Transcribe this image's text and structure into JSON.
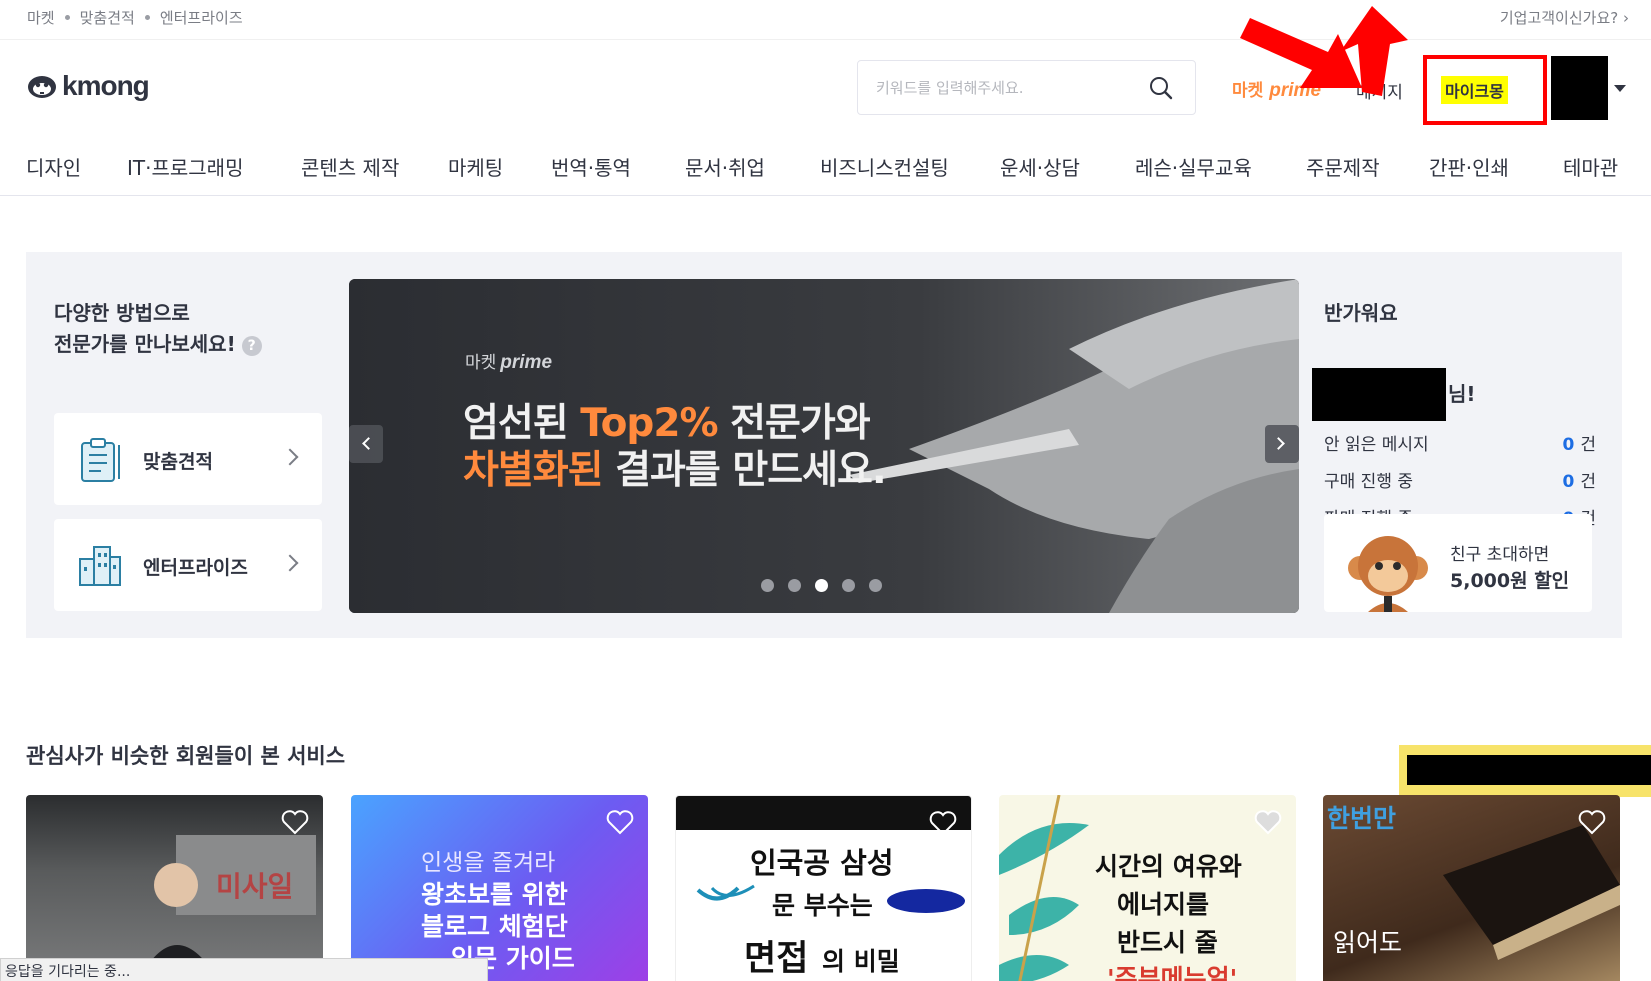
{
  "topbar": {
    "crumbs": [
      "마켓",
      "맞춤견적",
      "엔터프라이즈"
    ],
    "enterprise_link": "기업고객이신가요?"
  },
  "header": {
    "logo_text": "kmong",
    "search_placeholder": "키워드를 입력해주세요.",
    "prime_label_1": "마켓",
    "prime_label_2": "prime",
    "message_label": "메시지",
    "mykmong_label": "마이크몽"
  },
  "nav": {
    "categories": [
      "디자인",
      "IT·프로그래밍",
      "콘텐츠 제작",
      "마케팅",
      "번역·통역",
      "문서·취업",
      "비즈니스컨설팅",
      "운세·상담",
      "레슨·실무교육",
      "주문제작",
      "간판·인쇄",
      "테마관"
    ]
  },
  "hero": {
    "intro_line1": "다양한 방법으로",
    "intro_line2": "전문가를 만나보세요!",
    "help_mark": "?",
    "card1_label": "맞춤견적",
    "card2_label": "엔터프라이즈",
    "banner_brand_1": "마켓",
    "banner_brand_2": "prime",
    "banner_line1_a": "엄선된 ",
    "banner_line1_b": "Top2%",
    "banner_line1_c": " 전문가와",
    "banner_line2_a": "차별화된",
    "banner_line2_b": " 결과를 만드세요.",
    "active_slide": 3,
    "slide_count": 5
  },
  "welcome": {
    "greeting": "반가워요",
    "name_suffix": "님!",
    "stats": [
      {
        "label": "안 읽은 메시지",
        "count": "0",
        "unit": "건"
      },
      {
        "label": "구매 진행 중",
        "count": "0",
        "unit": "건"
      },
      {
        "label": "판매 진행 중",
        "count": "0",
        "unit": "건"
      }
    ],
    "invite_line1": "친구 초대하면",
    "invite_line2": "5,000원 할인"
  },
  "recommend": {
    "title": "관심사가 비슷한 회원들이 본 서비스",
    "cards": [
      {
        "text1": "미사일"
      },
      {
        "text1": "인생을 즐겨라",
        "text2": "왕초보를 위한",
        "text3": "블로그 체험단",
        "text4": "입문 가이드"
      },
      {
        "text1": "인국공 삼성",
        "text2": "문 부수는",
        "text3": "면접",
        "text4": "의 비밀"
      },
      {
        "text1": "시간의 여유와",
        "text2": "에너지를",
        "text3": "반드시 줄",
        "text4": "'주부메뉴얼'"
      },
      {
        "text1": "한번만",
        "text2": "읽어도"
      }
    ]
  },
  "status_bar": "응답을 기다리는 중...",
  "colors": {
    "accent_orange": "#ff8a3d",
    "count_blue": "#1d6de3",
    "annotation_red": "#ff0000",
    "highlight_yellow": "#ffff00"
  }
}
